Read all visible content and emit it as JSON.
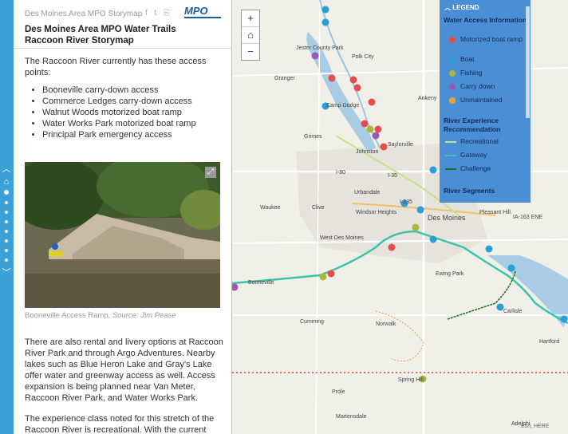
{
  "header": {
    "org_name": "Des Moines Area MPO Storymap",
    "share_icons": "f  t  ⎘",
    "logo": "MPO",
    "title": "Des Moines Area MPO Water Trails Raccoon River Storymap"
  },
  "content": {
    "intro": "The Raccoon River currently has these access points:",
    "access_points": [
      "Booneville carry-down access",
      "Commerce Ledges carry-down access",
      "Walnut Woods motorized boat ramp",
      "Water Works Park motorized boat ramp",
      "Principal Park emergency access"
    ],
    "photo_caption": "Booneville Access Ramp,",
    "photo_source": "Source: Jim Pease",
    "paragraph2": "There are also rental and livery options at Raccoon River Park and through Argo Adventures. Nearby lakes such as Blue Heron Lake and Gray's Lake offer water and greenway access as well. Access expansion is being planned near Van Meter, Raccoon River Park, and Water Works Park.",
    "paragraph3": "The experience class noted for this stretch of the Raccoon River is recreational. With the current"
  },
  "map": {
    "zoom_in": "+",
    "home": "⌂",
    "zoom_out": "−",
    "labels": {
      "jester": "Jester County Park",
      "polk": "Polk City",
      "granger": "Granger",
      "camp": "Camp Dodge",
      "ankeny": "Ankeny",
      "grimes": "Grimes",
      "johnston": "Johnston",
      "saylorville": "Saylorville",
      "urbandale": "Urbandale",
      "waukee": "Waukee",
      "clive": "Clive",
      "windsor": "Windsor Heights",
      "desmoines": "Des Moines",
      "wdm": "West Des Moines",
      "pleasant": "Pleasant Hill",
      "booneville": "Booneville",
      "ewing": "Ewing Park",
      "carlisle": "Carlisle",
      "cumming": "Cumming",
      "norwalk": "Norwalk",
      "hartford": "Hartford",
      "spring": "Spring Hill",
      "prole": "Prole",
      "martensdale": "Martensdale",
      "adelphi": "Adelphi",
      "hwy": "IA-163 ENE",
      "i80": "I-80",
      "i35": "I-35",
      "i235": "I-235"
    },
    "attribution": "Esri, HERE"
  },
  "legend": {
    "title": "LEGEND",
    "section1": "Water Access Information",
    "access_types": [
      {
        "label": "Motorized boat ramp",
        "color": "#e74c4c"
      },
      {
        "label": "Boat",
        "color": "#2b9fd3"
      },
      {
        "label": "Fishing",
        "color": "#a8b83a"
      },
      {
        "label": "Carry down",
        "color": "#9b59b6"
      },
      {
        "label": "Unmaintained",
        "color": "#f0a030"
      }
    ],
    "section2": "River Experience Recommendation",
    "experience_types": [
      {
        "label": "Recreational",
        "color": "#c6e28a"
      },
      {
        "label": "Gateway",
        "color": "#3cc4a8"
      },
      {
        "label": "Challenge",
        "color": "#1e6b2a"
      }
    ],
    "section3": "River Segments"
  }
}
